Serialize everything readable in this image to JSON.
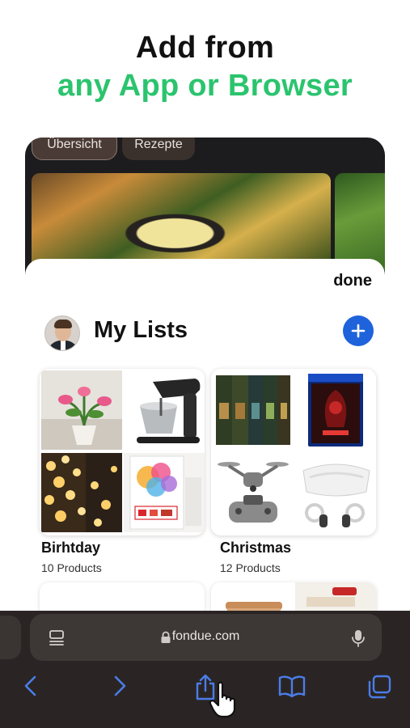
{
  "headline": {
    "line1": "Add from",
    "line2": "any App or Browser"
  },
  "colors": {
    "headline_accent": "#2bc46e",
    "add_button": "#1e63db",
    "browser_toolbar": "#2a2524",
    "browser_icons": "#4a7de8"
  },
  "app": {
    "tabs": [
      "Übersicht",
      "Rezepte"
    ],
    "done_label": "done",
    "section_title": "My Lists",
    "lists": [
      {
        "title": "Birhtday",
        "count": "10 Products"
      },
      {
        "title": "Christmas",
        "count": "12 Products"
      }
    ]
  },
  "browser": {
    "url": "fondue.com",
    "icons": [
      "reader-icon",
      "lock-icon",
      "mic-icon",
      "back-icon",
      "forward-icon",
      "share-icon",
      "bookmarks-icon",
      "tabs-icon"
    ]
  }
}
